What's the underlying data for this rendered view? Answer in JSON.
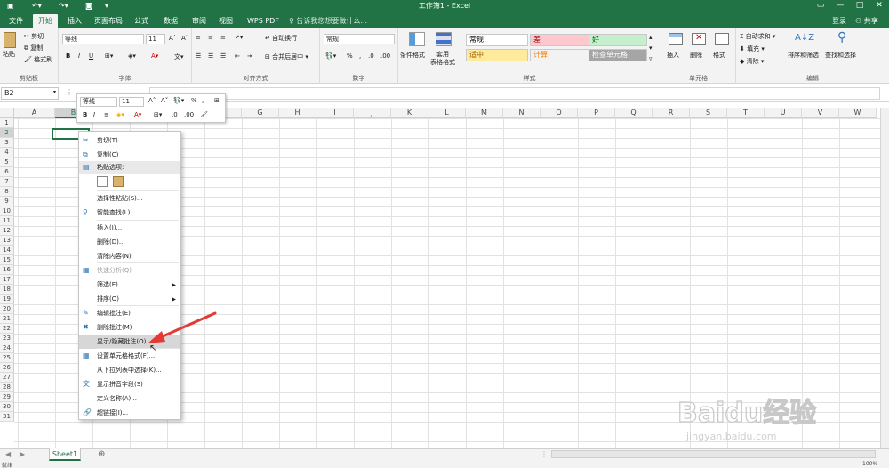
{
  "titlebar": {
    "title": "工作簿1 - Excel",
    "login_label": "登录",
    "share_label": "共享"
  },
  "tabs": [
    "文件",
    "开始",
    "插入",
    "页面布局",
    "公式",
    "数据",
    "审阅",
    "视图",
    "WPS PDF"
  ],
  "active_tab": "开始",
  "tellme_placeholder": "告诉我您想要做什么...",
  "ribbon": {
    "clipboard": {
      "label": "剪贴板",
      "paste": "粘贴",
      "cut": "剪切",
      "copy": "复制",
      "format_painter": "格式刷"
    },
    "font": {
      "label": "字体",
      "font_name": "等线",
      "font_size": "11"
    },
    "alignment": {
      "label": "对齐方式",
      "wrap_text": "自动换行",
      "merge_center": "合并后居中"
    },
    "number": {
      "label": "数字",
      "format": "常规"
    },
    "styles": {
      "label": "样式",
      "conditional_format": "条件格式",
      "table_format": "套用\n表格格式",
      "cells": [
        {
          "text": "常规",
          "bg": "#ffffff",
          "color": "#000000"
        },
        {
          "text": "差",
          "bg": "#ffc7ce",
          "color": "#9c0006"
        },
        {
          "text": "好",
          "bg": "#c6efce",
          "color": "#006100"
        },
        {
          "text": "适中",
          "bg": "#ffeb9c",
          "color": "#9c5700"
        },
        {
          "text": "计算",
          "bg": "#f2f2f2",
          "color": "#fa7d00"
        },
        {
          "text": "检查单元格",
          "bg": "#a5a5a5",
          "color": "#ffffff"
        }
      ]
    },
    "cells_group": {
      "label": "单元格",
      "insert": "插入",
      "delete": "删除",
      "format": "格式"
    },
    "editing": {
      "label": "编辑",
      "autosum": "自动求和",
      "fill": "填充",
      "clear": "清除",
      "sort_filter": "排序和筛选",
      "find_select": "查找和选择"
    }
  },
  "formula_bar": {
    "name_box": "B2",
    "fx": "fx"
  },
  "columns": [
    "A",
    "B",
    "C",
    "D",
    "E",
    "F",
    "G",
    "H",
    "I",
    "J",
    "K",
    "L",
    "M",
    "N",
    "O",
    "P",
    "Q",
    "R",
    "S",
    "T",
    "U",
    "V",
    "W"
  ],
  "rows": [
    "1",
    "2",
    "3",
    "4",
    "5",
    "6",
    "7",
    "8",
    "9",
    "10",
    "11",
    "12",
    "13",
    "14",
    "15",
    "16",
    "17",
    "18",
    "19",
    "20",
    "21",
    "22",
    "23",
    "24",
    "25",
    "26",
    "27",
    "28",
    "29",
    "30",
    "31"
  ],
  "mini_toolbar": {
    "font_name": "等线",
    "font_size": "11"
  },
  "context_menu": {
    "items": [
      {
        "label": "剪切(T)",
        "icon": "scissors-icon",
        "disabled": false
      },
      {
        "label": "复制(C)",
        "icon": "copy-icon",
        "disabled": false
      },
      {
        "label": "粘贴选项:",
        "icon": "paste-icon",
        "disabled": false,
        "header": true
      },
      {
        "label": "",
        "icon": "paste-options-icon",
        "disabled": false
      },
      {
        "label": "选择性粘贴(S)...",
        "icon": "",
        "disabled": false
      },
      {
        "label": "智能查找(L)",
        "icon": "search-icon",
        "disabled": false
      },
      {
        "label": "插入(I)...",
        "icon": "",
        "disabled": false
      },
      {
        "label": "删除(D)...",
        "icon": "",
        "disabled": false
      },
      {
        "label": "清除内容(N)",
        "icon": "",
        "disabled": false
      },
      {
        "label": "快速分析(Q)",
        "icon": "quick-analysis-icon",
        "disabled": true
      },
      {
        "label": "筛选(E)",
        "icon": "",
        "disabled": false,
        "submenu": true
      },
      {
        "label": "排序(O)",
        "icon": "",
        "disabled": false,
        "submenu": true
      },
      {
        "label": "编辑批注(E)",
        "icon": "edit-comment-icon",
        "disabled": false
      },
      {
        "label": "删除批注(M)",
        "icon": "delete-comment-icon",
        "disabled": false
      },
      {
        "label": "显示/隐藏批注(O)",
        "icon": "",
        "disabled": false,
        "highlight": true
      },
      {
        "label": "设置单元格格式(F)...",
        "icon": "format-cells-icon",
        "disabled": false
      },
      {
        "label": "从下拉列表中选择(K)...",
        "icon": "",
        "disabled": false
      },
      {
        "label": "显示拼音字段(S)",
        "icon": "phonetic-icon",
        "disabled": false
      },
      {
        "label": "定义名称(A)...",
        "icon": "",
        "disabled": false
      },
      {
        "label": "超链接(I)...",
        "icon": "hyperlink-icon",
        "disabled": false
      }
    ]
  },
  "sheet_tabs": [
    "Sheet1"
  ],
  "status": {
    "ready": "就绪",
    "zoom": "100%"
  },
  "watermark": {
    "brand": "Baidu经验",
    "url": "jingyan.baidu.com"
  },
  "colors": {
    "excel_green": "#217346",
    "arrow_red": "#e53935"
  }
}
